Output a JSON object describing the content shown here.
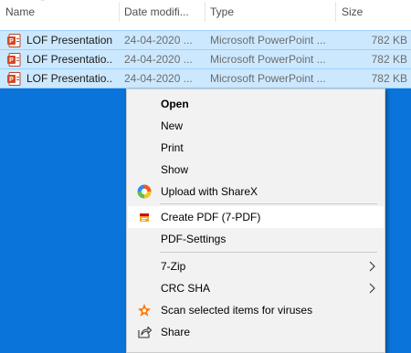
{
  "columns": {
    "name": "Name",
    "date": "Date modifi...",
    "type": "Type",
    "size": "Size"
  },
  "files": [
    {
      "name": "LOF Presentation",
      "date": "24-04-2020 ...",
      "type": "Microsoft PowerPoint ...",
      "size": "782 KB"
    },
    {
      "name": "LOF Presentatio...",
      "date": "24-04-2020 ...",
      "type": "Microsoft PowerPoint ...",
      "size": "782 KB"
    },
    {
      "name": "LOF Presentatio...",
      "date": "24-04-2020 ...",
      "type": "Microsoft PowerPoint ...",
      "size": "782 KB"
    }
  ],
  "menu": {
    "open": "Open",
    "new": "New",
    "print": "Print",
    "show": "Show",
    "upload_sharex": "Upload with ShareX",
    "create_pdf": "Create PDF (7-PDF)",
    "pdf_settings": "PDF-Settings",
    "seven_zip": "7-Zip",
    "crc_sha": "CRC SHA",
    "scan_viruses": "Scan selected items for viruses",
    "share": "Share"
  },
  "colors": {
    "desktop_bg": "#0a74da",
    "selection": "#cce8ff",
    "selection_border": "#99d1ff",
    "menu_bg": "#f2f2f2",
    "menu_hover": "#ffffff",
    "powerpoint": "#d24726",
    "avast": "#ff7800"
  },
  "icons": {
    "file": "powerpoint-file-icon",
    "sharex": "sharex-icon",
    "pdf": "pdf-icon",
    "scan": "avast-icon",
    "share": "share-icon",
    "submenu": "chevron-right-icon"
  }
}
